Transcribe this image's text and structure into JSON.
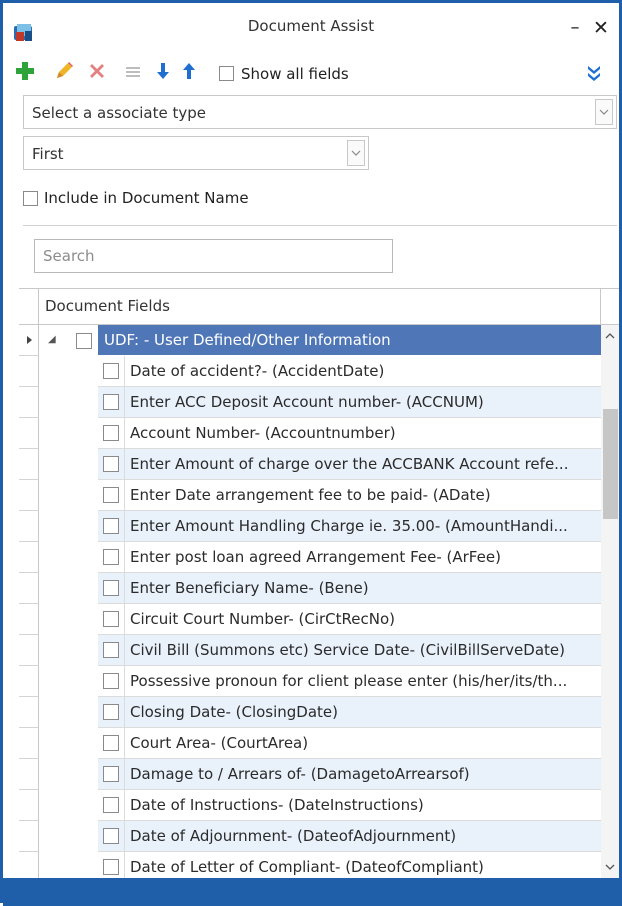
{
  "window": {
    "title": "Document Assist",
    "minimize_glyph": "–",
    "close_glyph": "✕",
    "icon": "app-icon"
  },
  "toolbar": {
    "buttons": [
      {
        "name": "add-icon",
        "color": "#2ea33a"
      },
      {
        "name": "edit-icon",
        "color": "#e0a020"
      },
      {
        "name": "delete-icon",
        "color": "#e07070"
      },
      {
        "name": "list-icon",
        "color": "#b8b8b8"
      },
      {
        "name": "arrow-down-icon",
        "color": "#1f6fd0"
      },
      {
        "name": "arrow-up-icon",
        "color": "#1f6fd0"
      }
    ],
    "show_all_label": "Show all fields",
    "expand_icon": "double-chevron-down-icon"
  },
  "associate_select": {
    "value": "Select a associate type"
  },
  "order_select": {
    "value": "First"
  },
  "include_label": "Include in Document Name",
  "search": {
    "placeholder": "Search"
  },
  "grid": {
    "header": "Document Fields",
    "group": {
      "label": "UDF:  - User Defined/Other Information",
      "color": "#4f77b8"
    },
    "fields": [
      "Date of accident?- (AccidentDate)",
      "Enter ACC Deposit Account number- (ACCNUM)",
      "Account Number- (Accountnumber)",
      "Enter Amount of charge over the ACCBANK Account refe...",
      "Enter Date arrangement fee to be paid- (ADate)",
      "Enter Amount Handling Charge ie. 35.00- (AmountHandi...",
      "Enter post loan agreed Arrangement Fee- (ArFee)",
      "Enter Beneficiary Name- (Bene)",
      "Circuit Court Number- (CirCtRecNo)",
      "Civil Bill (Summons etc) Service Date- (CivilBillServeDate)",
      "Possessive pronoun for client please enter (his/her/its/th...",
      "Closing Date- (ClosingDate)",
      "Court Area- (CourtArea)",
      "Damage to / Arrears of- (DamagetoArrearsof)",
      "Date of Instructions- (DateInstructions)",
      "Date of Adjournment- (DateofAdjournment)",
      "Date of Letter of Compliant- (DateofCompliant)"
    ]
  },
  "colors": {
    "accent": "#1f5ea8",
    "row_alt": "#e9f1fb"
  }
}
